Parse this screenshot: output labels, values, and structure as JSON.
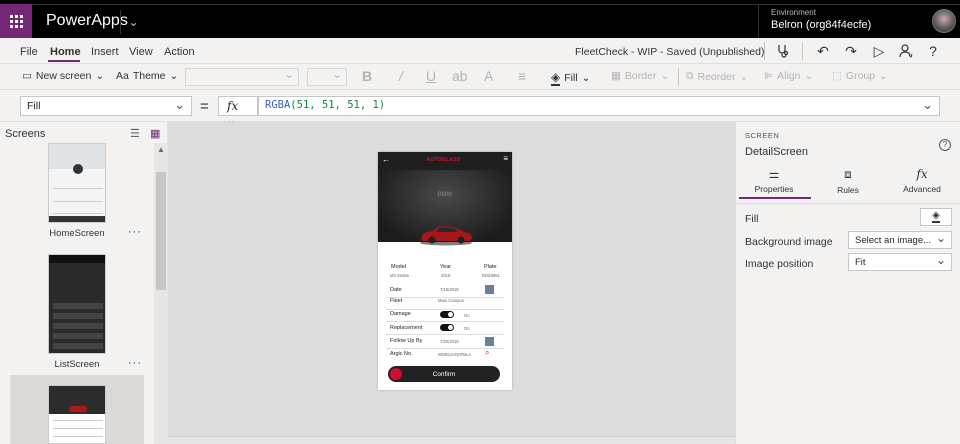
{
  "app": {
    "name": "PowerApps"
  },
  "environment": {
    "label": "Environment",
    "name": "Belron (org84f4ecfe)"
  },
  "menu": {
    "items": [
      "File",
      "Home",
      "Insert",
      "View",
      "Action"
    ],
    "active": "Home"
  },
  "document": {
    "status": "FleetCheck - WIP - Saved (Unpublished)"
  },
  "ribbon": {
    "new_screen": "New screen",
    "theme": "Theme",
    "fill": "Fill",
    "border": "Border",
    "reorder": "Reorder",
    "align": "Align",
    "group": "Group"
  },
  "formula": {
    "property": "Fill",
    "fx": "fx",
    "fn": "RGBA",
    "args": "(51, 51, 51, 1)"
  },
  "screens_panel": {
    "title": "Screens",
    "screens": [
      {
        "name": "HomeScreen",
        "more": "···"
      },
      {
        "name": "ListScreen",
        "more": "···"
      }
    ]
  },
  "phone": {
    "brand": "AUTOGLASS",
    "make": "BMW",
    "fields": {
      "model_label": "Model",
      "model_value": "M3 Sedan",
      "year_label": "Year",
      "year_value": "2015",
      "plate_label": "Plate",
      "plate_value": "RDZ6981",
      "date_label": "Date",
      "date_value": "7/16/2018",
      "fleet_label": "Fleet",
      "fleet_value": "Main Campus",
      "damage_label": "Damage",
      "damage_value": "On",
      "replacement_label": "Replacement",
      "replacement_value": "On",
      "followup_label": "Follow Up By",
      "followup_value": "7/20/2018",
      "argic_label": "Argic No.",
      "argic_value": "WDB12AN0FBLA"
    },
    "confirm": "Confirm"
  },
  "properties_panel": {
    "kind": "SCREEN",
    "name": "DetailScreen",
    "tabs": [
      {
        "label": "Properties",
        "icon": "sliders-icon"
      },
      {
        "label": "Rules",
        "icon": "rules-icon"
      },
      {
        "label": "Advanced",
        "icon": "fx-icon"
      }
    ],
    "props": {
      "fill_label": "Fill",
      "bg_image_label": "Background image",
      "bg_image_value": "Select an image...",
      "image_position_label": "Image position",
      "image_position_value": "Fit"
    }
  },
  "colors": {
    "brand": "#742774",
    "canvas": "#dcdcdc",
    "confirm_dot": "#d01030"
  }
}
